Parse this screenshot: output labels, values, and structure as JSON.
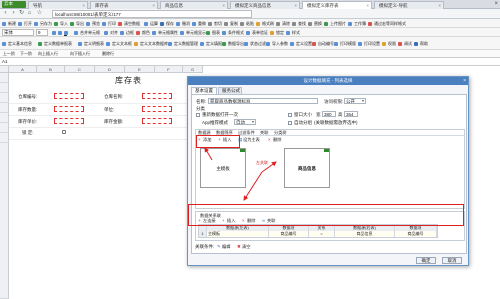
{
  "browser": {
    "logo": "云本",
    "tabs": [
      {
        "label": "导航"
      },
      {
        "label": "库存表"
      },
      {
        "label": "商品信息"
      },
      {
        "label": "模拟定义商品信息"
      },
      {
        "label": "模拟定义库存表",
        "active": true
      },
      {
        "label": "模拟定义-导航"
      }
    ],
    "address": "localhost:88/10001/表单定义/177"
  },
  "toolbar1": {
    "items": [
      "新建",
      "打开",
      "另存为",
      "导入",
      "导出",
      "预览",
      "打印",
      "清空数据",
      "运算",
      "保存",
      "撤消",
      "重做",
      "剪切",
      "复制",
      "粘贴",
      "格式刷",
      "清除",
      "查找",
      "替换",
      "上传图片",
      "工作簿"
    ],
    "font": "宋体",
    "size": "9",
    "trailing": "通过宏等同样格式"
  },
  "toolbar2": {
    "items": [
      "B",
      "I",
      "U",
      "合并单元格",
      "对齐",
      "边框",
      "颜色",
      "单元格属性",
      "单元格显示",
      "图表",
      "条件格式",
      "表单验证",
      "锁定",
      "样式"
    ]
  },
  "toolbar3": {
    "items": [
      "定义基本信息",
      "定义数据单报表",
      "定义明细表",
      "定义文本框",
      "定义文本数据库",
      "定义数据管理",
      "定义填报",
      "数据导出",
      "状态过滤",
      "导入参数",
      "定义设置",
      "自动编号",
      "打印模版",
      "打印设置",
      "权限",
      "调试",
      "帮助"
    ]
  },
  "ribbon2": [
    "上一阶",
    "下一阶",
    "向上插入行",
    "向下插入行",
    "删除行"
  ],
  "formula": {
    "cell": "A1"
  },
  "sheet": {
    "title": "库存表",
    "columns": [
      "A",
      "B",
      "C",
      "D",
      "E",
      "F",
      "G"
    ],
    "fields": [
      {
        "label": "仓库编号:"
      },
      {
        "label": "仓库名称:"
      },
      {
        "label": "库存数量:"
      },
      {
        "label": "单位:"
      },
      {
        "label": "库存单价:"
      },
      {
        "label": "库存金额:"
      },
      {
        "label": "锁 定:"
      }
    ]
  },
  "dialog": {
    "title": "设计数据填充 - 列表选择",
    "tabs": [
      "基本设置",
      "服务公式"
    ],
    "name_label": "名称:",
    "name_value": "获取商品数据源标准",
    "access_label": "访问权限:",
    "access_value": "公开",
    "category_label": "分类",
    "opt_auto_fill": "重新数据打开一次",
    "opt_window": "窗口大小",
    "width_label": "宽",
    "width_value": "380",
    "height_label": "高",
    "height_value": "364",
    "app_mode_label": "App推荐模式",
    "app_mode_value": "自动",
    "opt_auto_wrap": "自动分组",
    "opt_inactive": "(关联数据需放弃选中)",
    "ds_tabs": [
      "数据源",
      "数据筛序",
      "过滤条件",
      "关联",
      "分类树"
    ],
    "ds_buttons": [
      "添加",
      "插入",
      "设为主表",
      "删除"
    ],
    "main_table": "主模板",
    "secondary_table": "商品信息",
    "rel_label": "左关联",
    "rel_section": "数据关系联",
    "rel_buttons": [
      "左连接",
      "插入",
      "删除",
      "关联"
    ],
    "rel_head": [
      "",
      "数据源(左表)",
      "数据项",
      "关系",
      "数据源(右表)",
      "数据项"
    ],
    "rel_row": [
      "1",
      "主模板",
      "商品编号",
      "=",
      "商品信息",
      "商品编号"
    ],
    "cond_label": "关联条件:",
    "cond_edit": "编辑",
    "cond_clear": "清空",
    "ok": "确定",
    "cancel": "取消"
  },
  "colors": {
    "accent": "#4a7fc0",
    "annotation": "#e02020",
    "green": "#2f8a2f"
  }
}
